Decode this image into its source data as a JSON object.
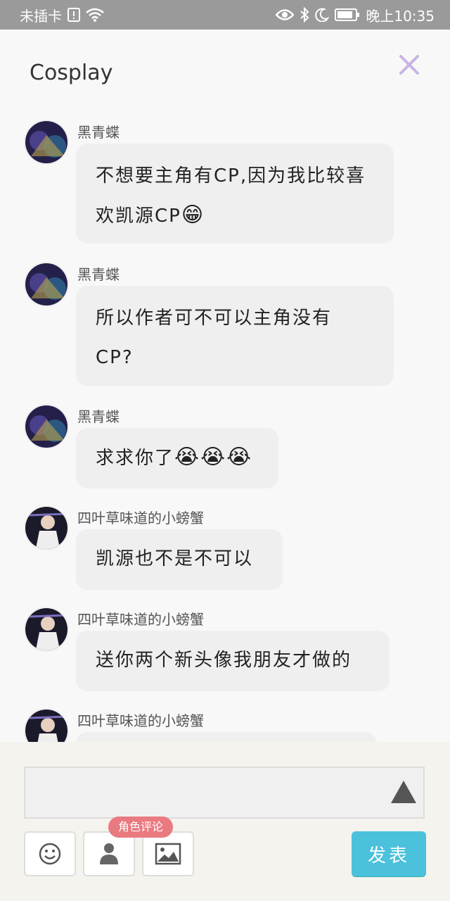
{
  "status_bar": {
    "carrier": "未插卡",
    "time": "晚上10:35"
  },
  "header": {
    "title": "Cosplay"
  },
  "messages": [
    {
      "author": "黑青蝶",
      "lines": [
        "不想要主角有CP,因为我比较喜",
        "欢凯源CP"
      ],
      "emoji": "😁",
      "avatar": "dark-avatar"
    },
    {
      "author": "黑青蝶",
      "lines": [
        "所以作者可不可以主角没有",
        "CP?"
      ],
      "emoji": "",
      "avatar": "dark-avatar"
    },
    {
      "author": "黑青蝶",
      "lines": [
        "求求你了"
      ],
      "emoji": "😭😭😭",
      "avatar": "dark-avatar"
    },
    {
      "author": "四叶草味道的小螃蟹",
      "lines": [
        "凯源也不是不可以"
      ],
      "emoji": "",
      "avatar": "white-avatar"
    },
    {
      "author": "四叶草味道的小螃蟹",
      "lines": [
        "送你两个新头像我朋友才做的"
      ],
      "emoji": "",
      "avatar": "white-avatar"
    },
    {
      "author": "四叶草味道的小螃蟹",
      "lines": [
        ""
      ],
      "emoji": "",
      "avatar": "white-avatar"
    }
  ],
  "composer": {
    "input_value": "",
    "role_badge": "角色评论",
    "publish_label": "发表"
  },
  "colors": {
    "accent": "#4cc1dc",
    "badge": "#e97a80",
    "close_icon": "#c9b3e6"
  }
}
